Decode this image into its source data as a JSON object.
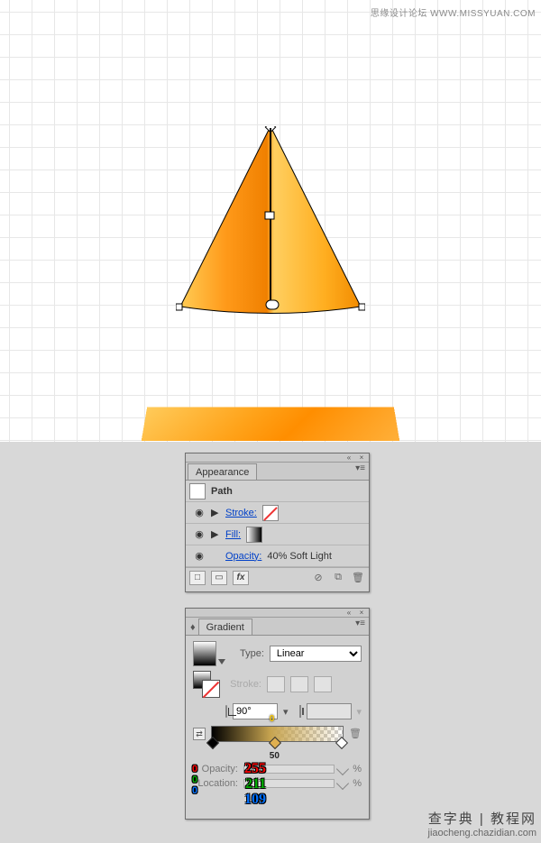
{
  "credit_top": "思缘设计论坛  WWW.MISSYUAN.COM",
  "appearance": {
    "title": "Appearance",
    "object": "Path",
    "stroke_label": "Stroke:",
    "fill_label": "Fill:",
    "opacity_label": "Opacity:",
    "opacity_value": "40% Soft Light",
    "fx_label": "fx"
  },
  "gradient": {
    "title": "Gradient",
    "type_label": "Type:",
    "type_value": "Linear",
    "stroke_label": "Stroke:",
    "angle_value": "90°",
    "aspect_value": "",
    "stop_top": "0",
    "stop_bottom": "50",
    "opacity_label": "Opacity:",
    "location_label": "Location:",
    "percent": "%"
  },
  "rgb_left": {
    "r": "0",
    "g": "0",
    "b": "0"
  },
  "rgb_mid": {
    "r": "255",
    "g": "211",
    "b": "109"
  },
  "watermark": {
    "cn": "查字典 | 教程网",
    "url": "jiaocheng.chazidian.com"
  }
}
